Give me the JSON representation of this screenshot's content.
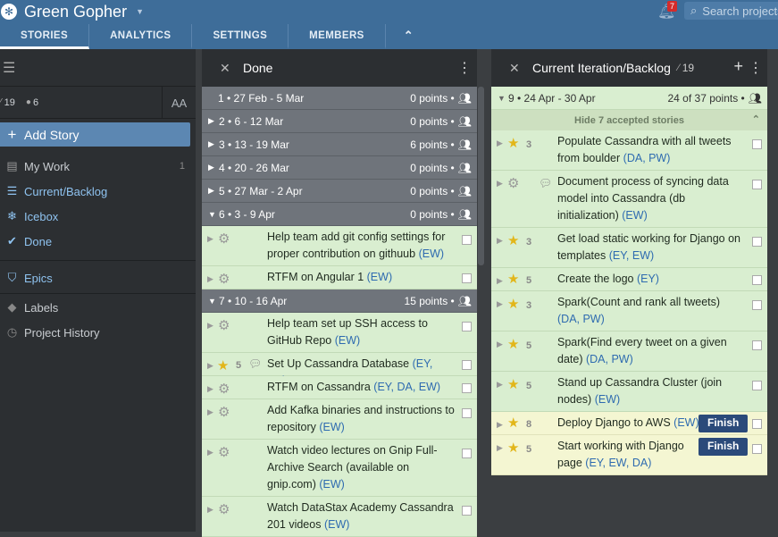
{
  "header": {
    "project_name": "Green Gopher",
    "notifications_count": "7",
    "search_placeholder": "Search projects",
    "tabs": [
      "STORIES",
      "ANALYTICS",
      "SETTINGS",
      "MEMBERS"
    ]
  },
  "sidebar": {
    "stats_velocity": "19",
    "stats_members": "6",
    "font_toggle": "AA",
    "add_story": "Add Story",
    "items": [
      {
        "label": "My Work",
        "count": "1"
      },
      {
        "label": "Current/Backlog"
      },
      {
        "label": "Icebox"
      },
      {
        "label": "Done"
      },
      {
        "label": "Epics"
      },
      {
        "label": "Labels"
      },
      {
        "label": "Project History"
      }
    ]
  },
  "done_panel": {
    "title": "Done",
    "iterations": [
      {
        "label": "1 • 27 Feb - 5 Mar",
        "points": "0 points •"
      },
      {
        "label": "2 • 6 - 12 Mar",
        "points": "0 points •"
      },
      {
        "label": "3 • 13 - 19 Mar",
        "points": "6 points •"
      },
      {
        "label": "4 • 20 - 26 Mar",
        "points": "0 points •"
      },
      {
        "label": "5 • 27 Mar - 2 Apr",
        "points": "0 points •"
      },
      {
        "label": "6 • 3 - 9 Apr",
        "points": "0 points •"
      },
      {
        "label": "7 • 10 - 16 Apr",
        "points": "15 points •"
      }
    ],
    "stories_iter6": [
      {
        "text": "Help team add git config settings for proper contribution on githuub",
        "owners": "(EW)"
      },
      {
        "text": "RTFM on Angular 1",
        "owners": "(EW)"
      }
    ],
    "stories_iter7": [
      {
        "text": "Help team set up SSH access to GitHub Repo",
        "owners": "(EW)"
      },
      {
        "text": "Set Up Cassandra Database",
        "owners": "(EY, DA)",
        "estimate": "5"
      },
      {
        "text": "RTFM on Cassandra",
        "owners": "(EY, DA, EW)"
      },
      {
        "text": "Add Kafka binaries and instructions to repository",
        "owners": "(EW)"
      },
      {
        "text": "Watch video lectures on Gnip Full-Archive Search (available on gnip.com)",
        "owners": "(EW)"
      },
      {
        "text": "Watch DataStax Academy Cassandra 201 videos",
        "owners": "(EW)"
      }
    ]
  },
  "current_panel": {
    "title": "Current Iteration/Backlog",
    "velocity": "19",
    "iteration": {
      "label": "9 • 24 Apr - 30 Apr",
      "points": "24 of 37 points •"
    },
    "hide_accepted": "Hide 7 accepted stories",
    "stories": [
      {
        "text": "Populate Cassandra with all tweets from boulder",
        "owners": "(DA, PW)",
        "estimate": "3"
      },
      {
        "text": "Document process of syncing data model into Cassandra (db initialization)",
        "owners": "(EW)"
      },
      {
        "text": "Get load static working for Django on templates",
        "owners": "(EY, EW)",
        "estimate": "3"
      },
      {
        "text": "Create the logo",
        "owners": "(EY)",
        "estimate": "5"
      },
      {
        "text": "Spark(Count and rank all tweets)",
        "owners": "(DA, PW)",
        "estimate": "3"
      },
      {
        "text": "Spark(Find every tweet on a given date)",
        "owners": "(DA, PW)",
        "estimate": "5"
      },
      {
        "text": "Stand up Cassandra Cluster (join nodes)",
        "owners": "(EW)",
        "estimate": "5"
      },
      {
        "text": "Deploy Django to AWS",
        "owners": "(EW)",
        "estimate": "8",
        "button": "Finish"
      },
      {
        "text": "Start working with Django page",
        "owners": "(EY, EW, DA)",
        "estimate": "5",
        "button": "Finish"
      }
    ]
  },
  "colors": {
    "header": "#3e6d99",
    "accepted": "#d9eed0",
    "started": "#f4f6d2",
    "finish_button": "#2b4a7a"
  }
}
